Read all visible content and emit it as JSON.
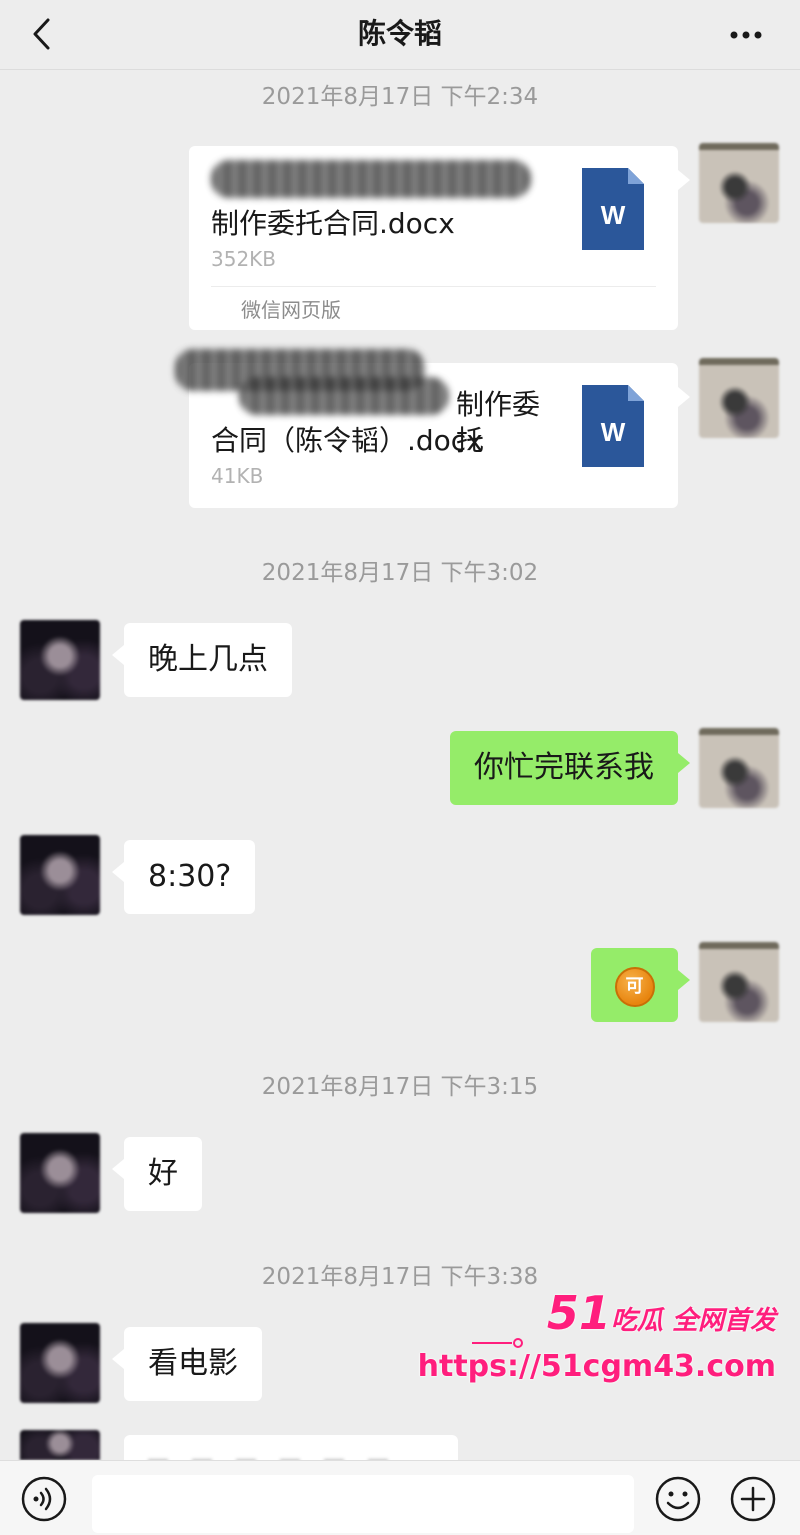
{
  "header": {
    "title": "陈令韬"
  },
  "timestamps": [
    "2021年8月17日 下午2:34",
    "2021年8月17日 下午3:02",
    "2021年8月17日 下午3:15",
    "2021年8月17日 下午3:38"
  ],
  "files": [
    {
      "name_line1": "",
      "name_line2": "制作委托合同.docx",
      "size": "352KB",
      "source": "微信网页版"
    },
    {
      "name_line1": "制作委托",
      "name_line2": "合同（陈令韬）.docx",
      "size": "41KB"
    }
  ],
  "messages": [
    {
      "side": "in",
      "text": "晚上几点"
    },
    {
      "side": "out",
      "text": "你忙完联系我"
    },
    {
      "side": "in",
      "text": "8:30?"
    },
    {
      "side": "out",
      "emoji": "可"
    },
    {
      "side": "in",
      "text": "好"
    },
    {
      "side": "in",
      "text": "看电影"
    }
  ],
  "icons": {
    "back": "chevron-left-icon",
    "more": "more-dots-icon",
    "voice": "voice-icon",
    "emoji": "emoji-icon",
    "plus": "plus-circle-icon",
    "file": "word-doc-icon"
  },
  "colors": {
    "background": "#ededed",
    "bubble_in": "#ffffff",
    "bubble_out": "#95ec69",
    "word_blue": "#2b579a",
    "watermark": "#ff1e7d"
  },
  "watermark": {
    "number": "51",
    "text": "吃瓜 全网首发",
    "url": "https://51cgm43.com"
  }
}
